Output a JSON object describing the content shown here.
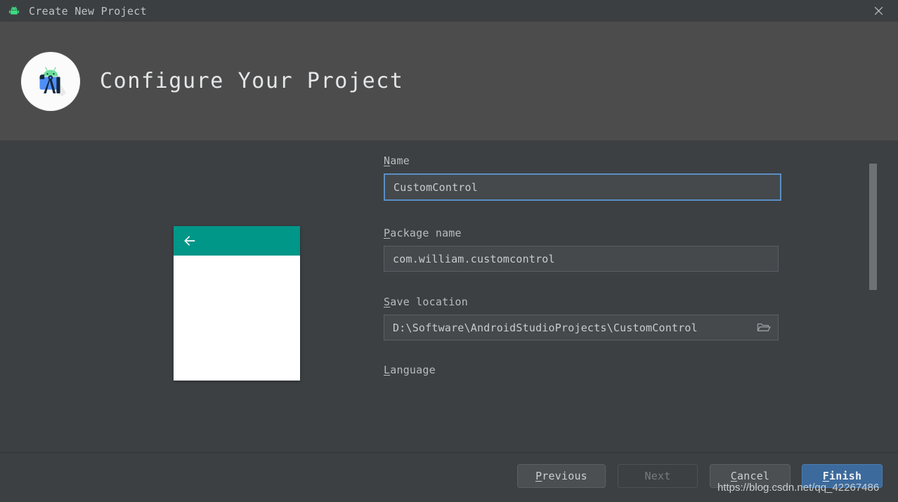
{
  "window": {
    "title": "Create New Project",
    "icon": "android-robot-icon",
    "close_icon": "close-icon"
  },
  "header": {
    "title": "Configure Your Project",
    "logo_icon": "android-studio-logo-icon"
  },
  "preview": {
    "name": "activity-preview",
    "appbar_color": "#009688",
    "back_icon": "back-arrow-icon",
    "content_color": "#ffffff"
  },
  "form": {
    "fields": [
      {
        "label_mnemonic": "N",
        "label_rest": "ame",
        "label_full": "Name",
        "value": "CustomControl",
        "focused": true,
        "has_browse": false
      },
      {
        "label_mnemonic": "P",
        "label_rest": "ackage name",
        "label_full": "Package name",
        "value": "com.william.customcontrol",
        "focused": false,
        "has_browse": false
      },
      {
        "label_mnemonic": "S",
        "label_rest": "ave location",
        "label_full": "Save location",
        "value": "D:\\Software\\AndroidStudioProjects\\CustomControl",
        "focused": false,
        "has_browse": true,
        "browse_icon": "folder-open-icon"
      }
    ],
    "language_label_mnemonic": "L",
    "language_label_rest": "anguage",
    "language_label_full": "Language"
  },
  "scrollbar": {
    "name": "vertical-scrollbar",
    "thumb_color": "#6e7275"
  },
  "footer": {
    "buttons": [
      {
        "mnemonic": "P",
        "rest": "revious",
        "full": "Previous",
        "state": "enabled"
      },
      {
        "mnemonic": "",
        "rest": "Next",
        "full": "Next",
        "state": "disabled"
      },
      {
        "mnemonic": "C",
        "rest": "ancel",
        "full": "Cancel",
        "state": "enabled"
      },
      {
        "mnemonic": "F",
        "rest": "inish",
        "full": "Finish",
        "state": "default"
      }
    ]
  },
  "watermark": {
    "text": "https://blog.csdn.net/qq_42267486"
  },
  "colors": {
    "titlebar_bg": "#3c3f41",
    "header_bg": "#4c4c4c",
    "body_bg": "#3c4043",
    "input_bg": "#45494c",
    "focus_border": "#5a8ec4",
    "finish_bg": "#3c6a9c",
    "appbar_teal": "#009688"
  }
}
